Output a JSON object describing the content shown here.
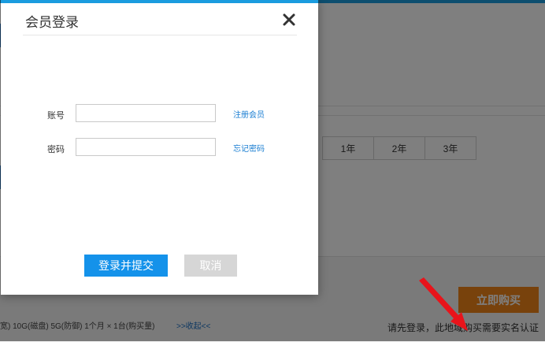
{
  "background": {
    "years": [
      "1年",
      "2年",
      "3年"
    ],
    "specs": "宽) 10G(磁盘) 5G(防御) 1个月 × 1台(购买量)",
    "collapse_link": ">>收起<<",
    "buy_button": "立即购买",
    "notice": "请先登录，此地域购买需要实名认证",
    "colors": {
      "buy": "#f08519",
      "arrow": "#e8141b",
      "accent": "#1a9cdf"
    }
  },
  "modal": {
    "title": "会员登录",
    "close_icon": "close-icon",
    "account": {
      "label": "账号",
      "value": "",
      "link": "注册会员"
    },
    "password": {
      "label": "密码",
      "value": "",
      "link": "忘记密码"
    },
    "submit_label": "登录并提交",
    "cancel_label": "取消",
    "colors": {
      "primary": "#1492ea",
      "cancel": "#d6d6d6",
      "link": "#1a7ed2"
    }
  }
}
